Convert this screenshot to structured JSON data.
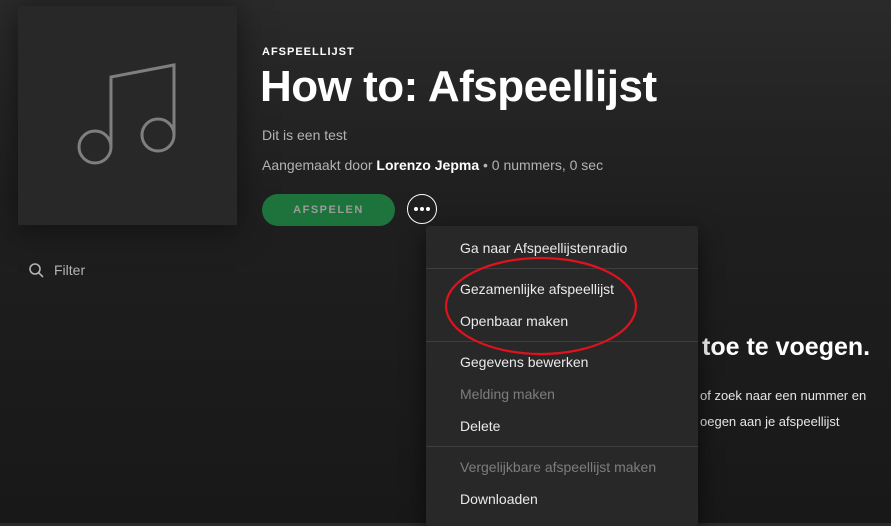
{
  "header": {
    "type_label": "AFSPEELLIJST",
    "title": "How to: Afspeellijst",
    "description": "Dit is een test",
    "created_by_prefix": "Aangemaakt door",
    "owner": "Lorenzo Jepma",
    "stats": "• 0 nummers, 0 sec"
  },
  "actions": {
    "play_label": "AFSPELEN",
    "play_color": "#1db954",
    "more_icon": "more-dots-icon"
  },
  "filter": {
    "placeholder": "Filter",
    "icon": "search-icon"
  },
  "empty_state": {
    "title": "toe te voegen.",
    "line1": "of zoek naar een nummer en",
    "line2": "oegen aan je afspeellijst"
  },
  "context_menu": {
    "groups": [
      [
        {
          "label": "Ga naar Afspeellijstenradio",
          "enabled": true
        }
      ],
      [
        {
          "label": "Gezamenlijke afspeellijst",
          "enabled": true
        },
        {
          "label": "Openbaar maken",
          "enabled": true
        }
      ],
      [
        {
          "label": "Gegevens bewerken",
          "enabled": true
        },
        {
          "label": "Melding maken",
          "enabled": false
        },
        {
          "label": "Delete",
          "enabled": true
        }
      ],
      [
        {
          "label": "Vergelijkbare afspeellijst maken",
          "enabled": false
        },
        {
          "label": "Downloaden",
          "enabled": true
        }
      ]
    ]
  },
  "annotation": {
    "shape": "ellipse",
    "color": "#e0121e"
  }
}
